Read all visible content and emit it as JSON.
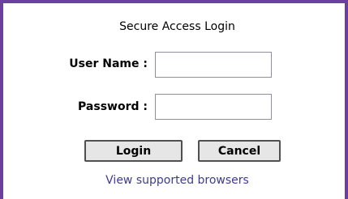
{
  "login": {
    "title": "Secure Access Login",
    "username_label": "User Name :",
    "username_value": "",
    "password_label": "Password :",
    "password_value": "",
    "login_button": "Login",
    "cancel_button": "Cancel",
    "browsers_link": "View supported browsers"
  },
  "colors": {
    "frame": "#6b3fa0",
    "link": "#3d3d8f"
  }
}
